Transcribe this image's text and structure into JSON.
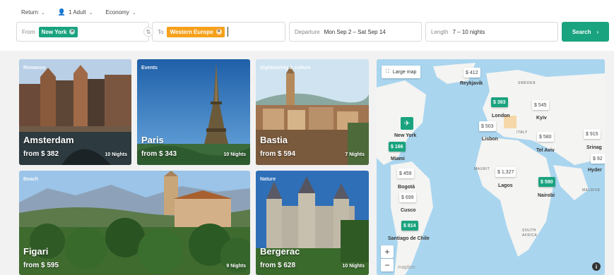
{
  "options": {
    "trip_type": "Return",
    "passengers": "1 Adult",
    "cabin": "Economy"
  },
  "from_field": {
    "label": "From",
    "chip": "New York",
    "chip_color": "#1aa37f"
  },
  "to_field": {
    "label": "To",
    "chip": "Western Europe",
    "chip_color": "#f5a11c"
  },
  "departure_field": {
    "label": "Departure",
    "value": "Mon Sep 2 – Sat Sep 14"
  },
  "length_field": {
    "label": "Length",
    "value": "7 – 10 nights"
  },
  "search_button": {
    "label": "Search",
    "icon": "chevron-right-icon"
  },
  "accent_color": "#1aa37f",
  "destinations": [
    {
      "category": "Romance",
      "city": "Amsterdam",
      "price": "from $ 382",
      "nights": "10 Nights"
    },
    {
      "category": "Events",
      "city": "Paris",
      "price": "from $ 343",
      "nights": "10 Nights"
    },
    {
      "category": "Sightseeing & culture",
      "city": "Bastia",
      "price": "from $ 594",
      "nights": "7 Nights"
    },
    {
      "category": "Beach",
      "city": "Figari",
      "price": "from $ 595",
      "nights": "9 Nights"
    },
    {
      "category": "Nature",
      "city": "Bergerac",
      "price": "from $ 628",
      "nights": "10 Nights"
    }
  ],
  "map": {
    "large_map_label": "Large map",
    "pins": [
      {
        "price": "$ 412",
        "city": "Reykjavik",
        "highlight": false
      },
      {
        "price": "$ 393",
        "city": "London",
        "highlight": true
      },
      {
        "price": "$ 545",
        "city": "Kyiv",
        "highlight": false
      },
      {
        "price": "$ 503",
        "city": "Lisbon",
        "highlight": false
      },
      {
        "price": "$ 580",
        "city": "Tel Aviv",
        "highlight": false
      },
      {
        "price": "$ 915",
        "city": "Srinag",
        "highlight": false
      },
      {
        "price": "$ 92",
        "city": "Hyder",
        "highlight": false
      },
      {
        "price": "$ 166",
        "city": "Miami",
        "highlight": true
      },
      {
        "price": "$ 459",
        "city": "Bogotá",
        "highlight": false
      },
      {
        "price": "$ 699",
        "city": "Cusco",
        "highlight": false
      },
      {
        "price": "$ 814",
        "city": "Santiago de Chile",
        "highlight": true
      },
      {
        "price": "$ 1,327",
        "city": "Lagos",
        "highlight": false
      },
      {
        "price": "$ 590",
        "city": "Nairobi",
        "highlight": true
      }
    ],
    "origin_city": "New York",
    "region_labels": [
      "SWEDEN",
      "ITALY",
      "MAURIT",
      "SOUTH AFRICA",
      "MALDIVE"
    ],
    "zoom_in": "+",
    "zoom_out": "−",
    "attribution": "mapbox",
    "info_icon": "i"
  }
}
